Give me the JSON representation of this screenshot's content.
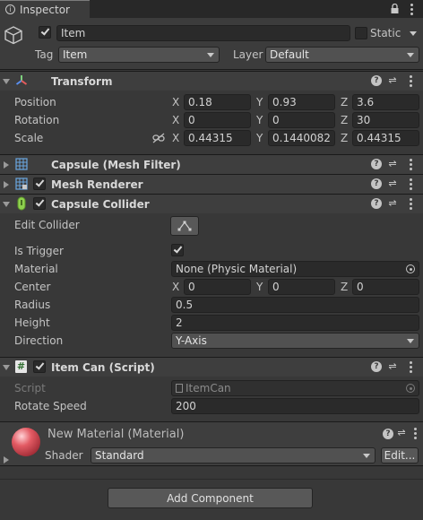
{
  "window": {
    "tab_title": "Inspector"
  },
  "object": {
    "active": true,
    "name": "Item",
    "static_label": "Static",
    "static_checked": false,
    "tag_label": "Tag",
    "tag_value": "Item",
    "layer_label": "Layer",
    "layer_value": "Default"
  },
  "transform": {
    "title": "Transform",
    "position_label": "Position",
    "rotation_label": "Rotation",
    "scale_label": "Scale",
    "axis_x": "X",
    "axis_y": "Y",
    "axis_z": "Z",
    "position": {
      "x": "0.18",
      "y": "0.93",
      "z": "3.6"
    },
    "rotation": {
      "x": "0",
      "y": "0",
      "z": "30"
    },
    "scale": {
      "x": "0.44315",
      "y": "0.1440082",
      "z": "0.44315"
    }
  },
  "mesh_filter": {
    "title": "Capsule (Mesh Filter)"
  },
  "mesh_renderer": {
    "title": "Mesh Renderer",
    "enabled": true
  },
  "capsule_collider": {
    "title": "Capsule Collider",
    "enabled": true,
    "edit_collider_label": "Edit Collider",
    "is_trigger_label": "Is Trigger",
    "is_trigger": true,
    "material_label": "Material",
    "material_value": "None (Physic Material)",
    "center_label": "Center",
    "center": {
      "x": "0",
      "y": "0",
      "z": "0"
    },
    "radius_label": "Radius",
    "radius_value": "0.5",
    "height_label": "Height",
    "height_value": "2",
    "direction_label": "Direction",
    "direction_value": "Y-Axis"
  },
  "item_can": {
    "title": "Item Can (Script)",
    "enabled": true,
    "script_label": "Script",
    "script_value": "ItemCan",
    "rotate_speed_label": "Rotate Speed",
    "rotate_speed_value": "200"
  },
  "material": {
    "title": "New Material (Material)",
    "shader_label": "Shader",
    "shader_value": "Standard",
    "edit_button": "Edit...",
    "preview_color": "#e35b64"
  },
  "add_component_label": "Add Component"
}
